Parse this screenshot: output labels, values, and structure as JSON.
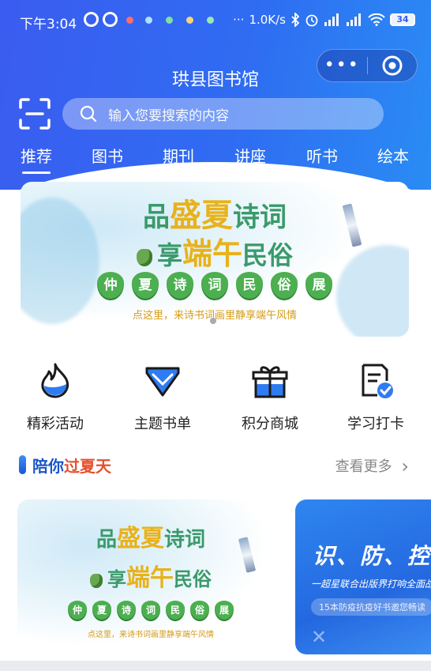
{
  "status_bar": {
    "time": "下午3:04",
    "network_speed": "1.0K/s",
    "battery": "34",
    "more_glyph": "···"
  },
  "title_bar": {
    "title": "珙县图书馆",
    "more_glyph": "•••"
  },
  "search": {
    "placeholder": "输入您要搜索的内容"
  },
  "tabs": [
    {
      "label": "推荐",
      "active": true
    },
    {
      "label": "图书",
      "active": false
    },
    {
      "label": "期刊",
      "active": false
    },
    {
      "label": "讲座",
      "active": false
    },
    {
      "label": "听书",
      "active": false
    },
    {
      "label": "绘本",
      "active": false
    }
  ],
  "banner": {
    "line1_a": "品",
    "line1_b": "盛夏",
    "line1_c": "诗词",
    "line2_a": "享",
    "line2_b": "端午",
    "line2_c": "民俗",
    "leaves": [
      "仲",
      "夏",
      "诗",
      "词",
      "民",
      "俗",
      "展"
    ],
    "subtitle": "点这里，来诗书词画里静享端午风情"
  },
  "quick_menu": [
    {
      "label": "精彩活动",
      "icon": "flame-icon"
    },
    {
      "label": "主题书单",
      "icon": "diamond-icon"
    },
    {
      "label": "积分商城",
      "icon": "gift-icon"
    },
    {
      "label": "学习打卡",
      "icon": "checklist-icon"
    }
  ],
  "section": {
    "title_a": "陪你",
    "title_b": "过夏天",
    "more": "查看更多",
    "more_glyph": "›"
  },
  "cards": {
    "card1": {
      "line1_a": "品",
      "line1_b": "盛夏",
      "line1_c": "诗词",
      "line2_a": "享",
      "line2_b": "端午",
      "line2_c": "民俗",
      "leaves": [
        "仲",
        "夏",
        "诗",
        "词",
        "民",
        "俗",
        "展"
      ],
      "subtitle": "点这里，来诗书词画里静享端午风情"
    },
    "card2": {
      "headline": "识、防、控、治",
      "subline": "一超星联合出版界打响全面战",
      "pill": "15本防疫抗疫好书邀您畅读",
      "mark": "✕"
    }
  },
  "colors": {
    "header_start": "#3b5cf0",
    "header_end": "#2a8cf4",
    "accent_blue": "#1f6ff0",
    "green": "#4caf50",
    "gold": "#e8b21c"
  }
}
